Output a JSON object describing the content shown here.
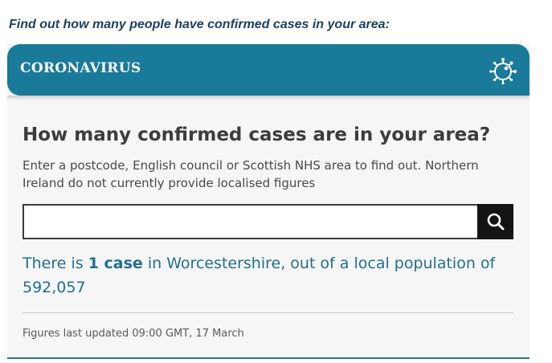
{
  "intro_text": "Find out how many people have confirmed cases in your area:",
  "banner": {
    "title": "CORONAVIRUS",
    "icon": "virus-icon",
    "background_color": "#1a7a9a"
  },
  "widget": {
    "heading": "How many confirmed cases are in your area?",
    "description": "Enter a postcode, English council or Scottish NHS area to find out. Northern Ireland do not currently provide localised figures",
    "search": {
      "value": "",
      "placeholder": "",
      "button_icon": "search-icon"
    },
    "result": {
      "prefix": "There is ",
      "count": "1 case",
      "suffix": " in Worcestershire, out of a local population of 592,057"
    },
    "updated": "Figures last updated 09:00 GMT, 17 March"
  },
  "colors": {
    "accent": "#1a7a9a",
    "result_text": "#1f6f8f",
    "search_button": "#141414"
  }
}
